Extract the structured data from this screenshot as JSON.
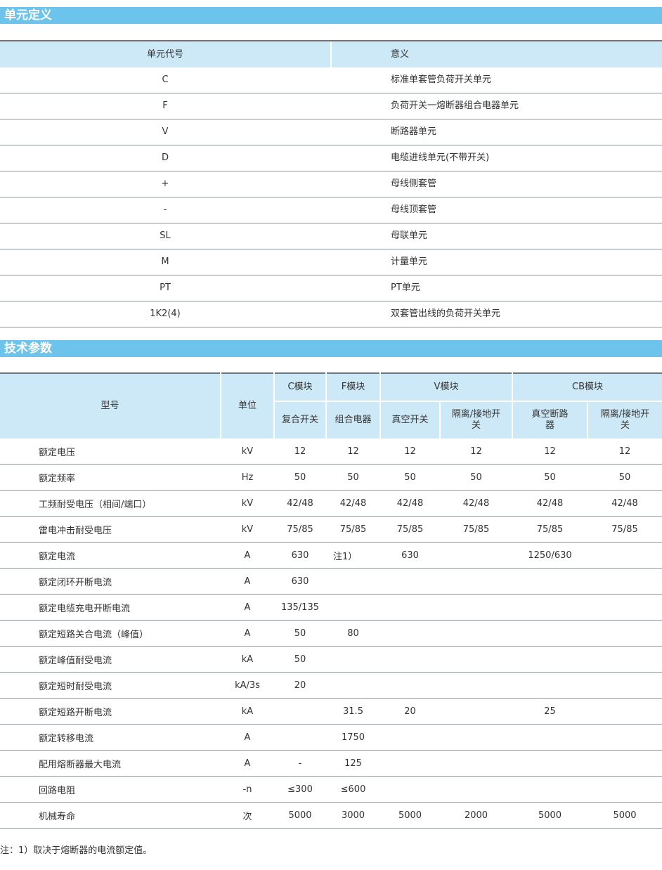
{
  "section1": {
    "title": "单元定义",
    "headers": [
      "单元代号",
      "意义"
    ],
    "rows": [
      {
        "code": "C",
        "meaning": "标准单套管负荷开关单元"
      },
      {
        "code": "F",
        "meaning": "负荷开关一熔断器组合电器单元"
      },
      {
        "code": "V",
        "meaning": "断路器单元"
      },
      {
        "code": "D",
        "meaning": "电缆进线单元(不带开关)"
      },
      {
        "code": "+",
        "meaning": "母线侧套管"
      },
      {
        "code": "-",
        "meaning": "母线顶套管"
      },
      {
        "code": "SL",
        "meaning": "母联单元"
      },
      {
        "code": "M",
        "meaning": "计量单元"
      },
      {
        "code": "PT",
        "meaning": "PT单元"
      },
      {
        "code": "1K2(4)",
        "meaning": "双套管出线的负荷开关单元"
      }
    ]
  },
  "section2": {
    "title": "技术参数",
    "headers": {
      "model": "型号",
      "unit": "单位",
      "c_module": "C模块",
      "f_module": "F模块",
      "v_module": "V模块",
      "cb_module": "CB模块",
      "sub": [
        "复合开关",
        "组合电器",
        "真空开关",
        "隔离/接地开关",
        "真空断路器",
        "隔离/接地开关"
      ]
    },
    "rows": [
      {
        "name": "额定电压",
        "unit": "kV",
        "values": [
          "12",
          "12",
          "12",
          "12",
          "12",
          "12"
        ]
      },
      {
        "name": "额定频率",
        "unit": "Hz",
        "values": [
          "50",
          "50",
          "50",
          "50",
          "50",
          "50"
        ]
      },
      {
        "name": "工频耐受电压（相间/端口）",
        "unit": "kV",
        "values": [
          "42/48",
          "42/48",
          "42/48",
          "42/48",
          "42/48",
          "42/48"
        ]
      },
      {
        "name": "雷电冲击耐受电压",
        "unit": "kV",
        "values": [
          "75/85",
          "75/85",
          "75/85",
          "75/85",
          "75/85",
          "75/85"
        ]
      },
      {
        "name": "额定电流",
        "unit": "A",
        "values": [
          "630",
          "注1）",
          "630",
          "",
          "1250/630",
          ""
        ]
      },
      {
        "name": "额定闭环开断电流",
        "unit": "A",
        "values": [
          "630",
          "",
          "",
          "",
          "",
          ""
        ]
      },
      {
        "name": "额定电缆充电开断电流",
        "unit": "A",
        "values": [
          "135/135",
          "",
          "",
          "",
          "",
          ""
        ]
      },
      {
        "name": "额定短路关合电流（峰值）",
        "unit": "A",
        "values": [
          "50",
          "80",
          "",
          "",
          "",
          ""
        ]
      },
      {
        "name": "额定峰值耐受电流",
        "unit": "kA",
        "values": [
          "50",
          "",
          "",
          "",
          "",
          ""
        ]
      },
      {
        "name": "额定短时耐受电流",
        "unit": "kA/3s",
        "values": [
          "20",
          "",
          "",
          "",
          "",
          ""
        ]
      },
      {
        "name": "额定短路开断电流",
        "unit": "kA",
        "values": [
          "",
          "31.5",
          "20",
          "",
          "25",
          ""
        ]
      },
      {
        "name": "额定转移电流",
        "unit": "A",
        "values": [
          "",
          "1750",
          "",
          "",
          "",
          ""
        ]
      },
      {
        "name": "配用熔断器最大电流",
        "unit": "A",
        "values": [
          "-",
          "125",
          "",
          "",
          "",
          ""
        ]
      },
      {
        "name": "回路电阻",
        "unit": "-n",
        "values": [
          "≤300",
          "≤600",
          "",
          "",
          "",
          ""
        ]
      },
      {
        "name": "机械寿命",
        "unit": "次",
        "values": [
          "5000",
          "3000",
          "5000",
          "2000",
          "5000",
          "5000"
        ]
      }
    ],
    "note": "注：1）取决于熔断器的电流额定值。"
  }
}
